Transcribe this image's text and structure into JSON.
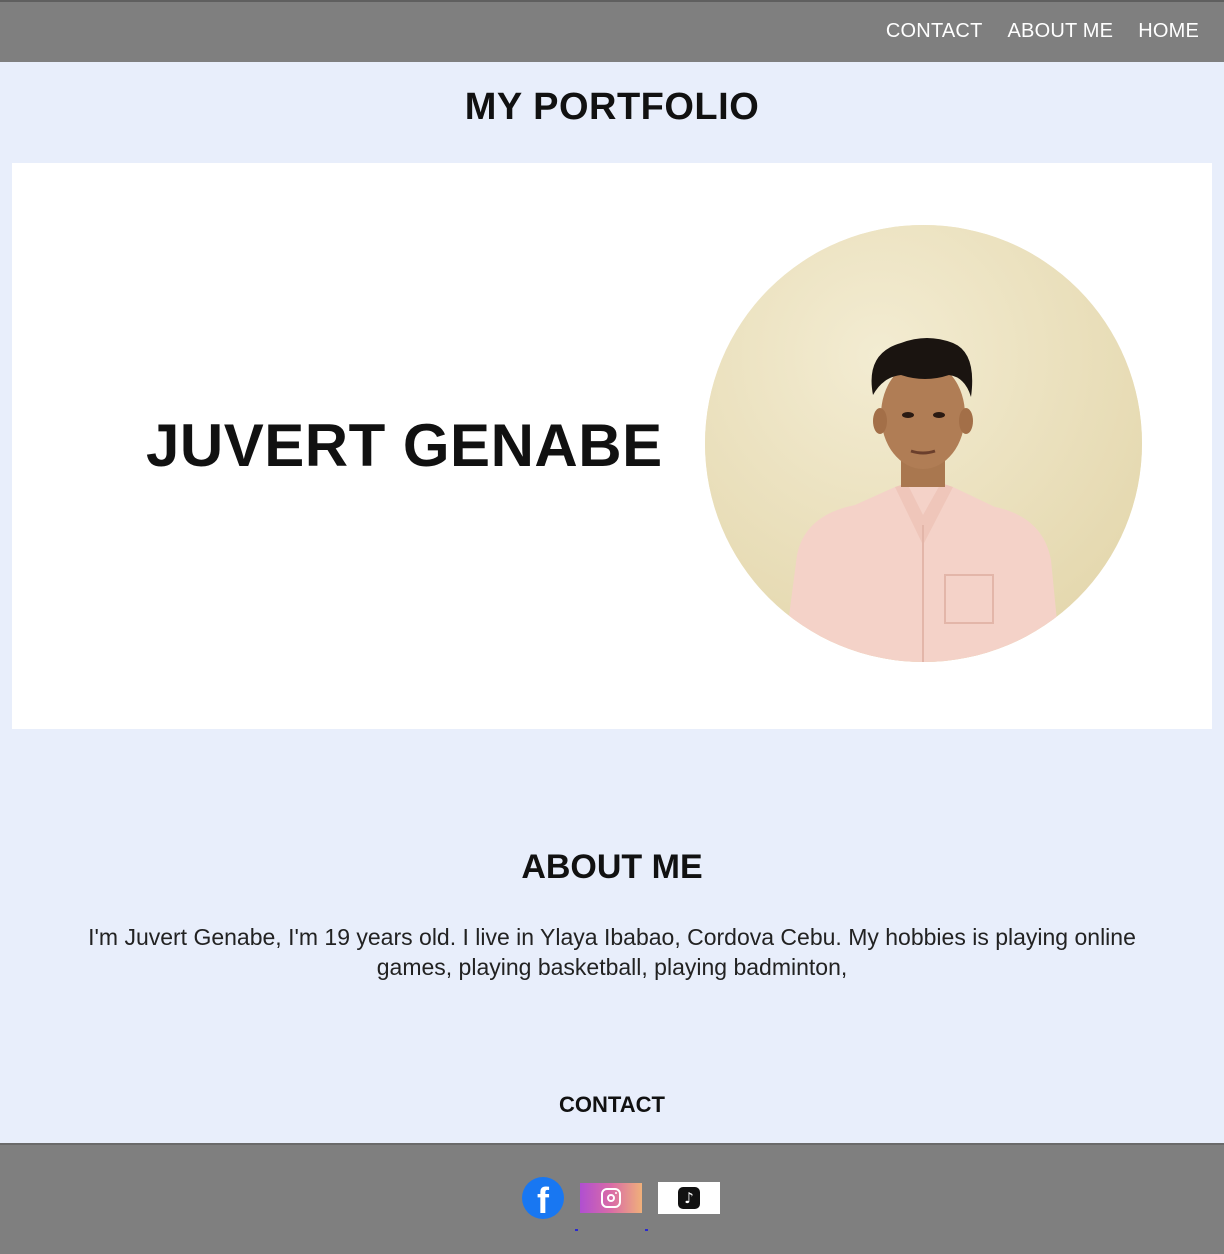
{
  "nav": {
    "items": [
      "CONTACT",
      "ABOUT ME",
      "HOME"
    ]
  },
  "page_title": "MY PORTFOLIO",
  "hero": {
    "name": "JUVERT GENABE",
    "photo_icon": "profile-photo"
  },
  "about": {
    "title": "ABOUT ME",
    "text": "I'm Juvert Genabe, I'm 19 years old. I live in Ylaya Ibabao, Cordova Cebu. My hobbies is playing online games, playing basketball, playing badminton,"
  },
  "contact": {
    "title": "CONTACT"
  },
  "footer": {
    "socials": [
      {
        "icon": "facebook-icon",
        "glyph": "f",
        "color": "#1877f2"
      },
      {
        "icon": "instagram-icon",
        "color": "#c95aa8"
      },
      {
        "icon": "tiktok-icon",
        "glyph": "♪",
        "color": "#111111"
      }
    ]
  },
  "colors": {
    "page_bg": "#e8eefb",
    "bar_bg": "#7f7f7f",
    "card_bg": "#ffffff"
  }
}
